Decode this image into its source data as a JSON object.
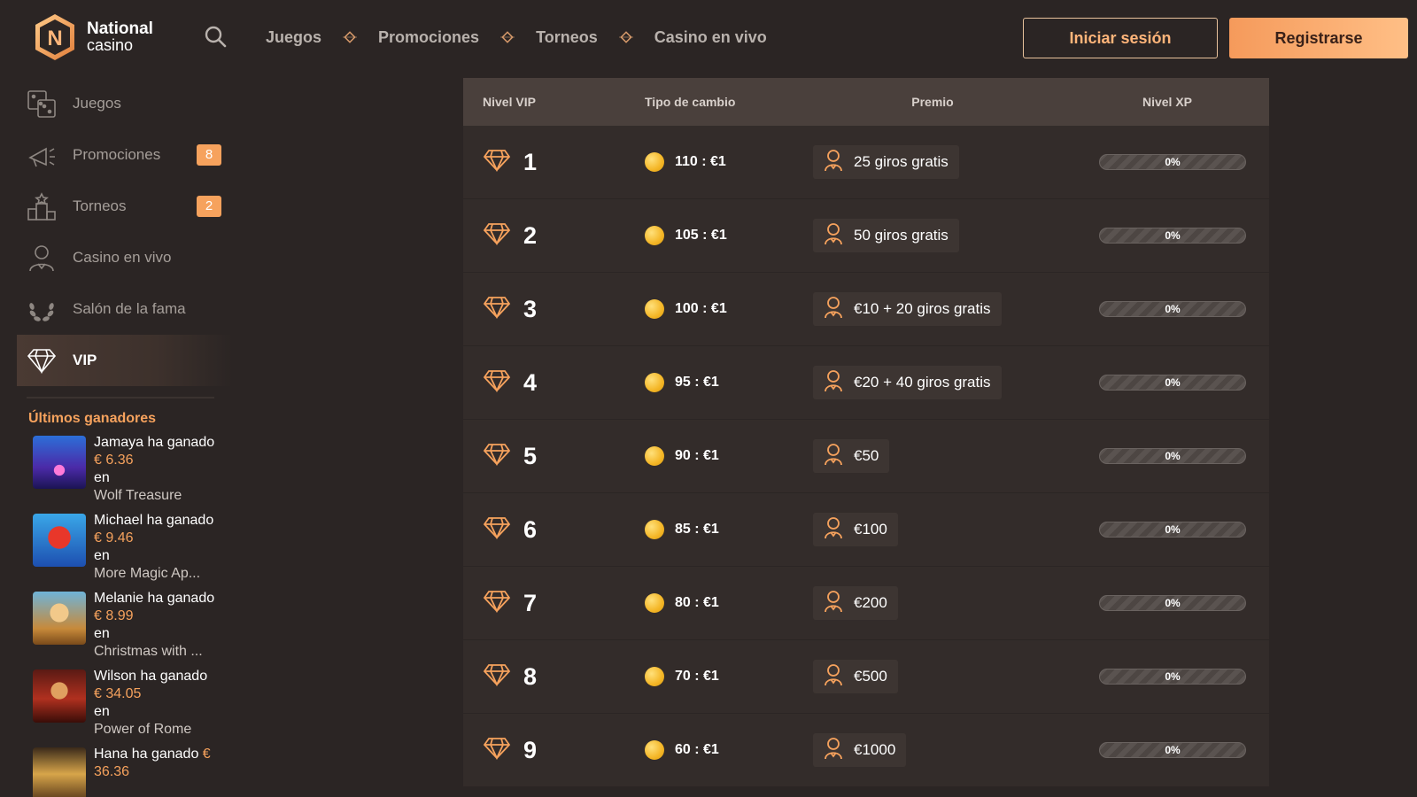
{
  "brand": {
    "line1": "National",
    "line2": "casino",
    "mark": "N"
  },
  "topnav": [
    "Juegos",
    "Promociones",
    "Torneos",
    "Casino en vivo"
  ],
  "auth": {
    "login": "Iniciar sesión",
    "register": "Registrarse"
  },
  "sidebar": {
    "items": [
      {
        "label": "Juegos",
        "icon": "games-icon",
        "badge": ""
      },
      {
        "label": "Promociones",
        "icon": "megaphone-icon",
        "badge": "8"
      },
      {
        "label": "Torneos",
        "icon": "podium-icon",
        "badge": "2"
      },
      {
        "label": "Casino en vivo",
        "icon": "dealer-icon",
        "badge": ""
      },
      {
        "label": "Salón de la fama",
        "icon": "laurel-icon",
        "badge": ""
      },
      {
        "label": "VIP",
        "icon": "diamond-icon",
        "badge": "",
        "active": true
      }
    ]
  },
  "winners": {
    "title": "Últimos ganadores",
    "won_word": "ha ganado",
    "in_word": "en",
    "items": [
      {
        "name": "Jamaya",
        "amount": "€ 6.36",
        "game": "Wolf Treasure"
      },
      {
        "name": "Michael",
        "amount": "€ 9.46",
        "game": "More Magic Ap..."
      },
      {
        "name": "Melanie",
        "amount": "€ 8.99",
        "game": "Christmas with ..."
      },
      {
        "name": "Wilson",
        "amount": "€ 34.05",
        "game": "Power of Rome"
      },
      {
        "name": "Hana",
        "amount": "€ 36.36",
        "game": ""
      }
    ]
  },
  "vip_table": {
    "headers": {
      "level": "Nivel VIP",
      "rate": "Tipo de cambio",
      "prize": "Premio",
      "xp": "Nivel XP"
    },
    "rows": [
      {
        "level": "1",
        "rate": "110 : €1",
        "prize": "25 giros gratis",
        "xp": "0%",
        "xp_value": 0
      },
      {
        "level": "2",
        "rate": "105 : €1",
        "prize": "50 giros gratis",
        "xp": "0%",
        "xp_value": 0
      },
      {
        "level": "3",
        "rate": "100 : €1",
        "prize": "€10 + 20 giros gratis",
        "xp": "0%",
        "xp_value": 0
      },
      {
        "level": "4",
        "rate": "95 : €1",
        "prize": "€20 + 40 giros gratis",
        "xp": "0%",
        "xp_value": 0
      },
      {
        "level": "5",
        "rate": "90 : €1",
        "prize": "€50",
        "xp": "0%",
        "xp_value": 0
      },
      {
        "level": "6",
        "rate": "85 : €1",
        "prize": "€100",
        "xp": "0%",
        "xp_value": 0
      },
      {
        "level": "7",
        "rate": "80 : €1",
        "prize": "€200",
        "xp": "0%",
        "xp_value": 0
      },
      {
        "level": "8",
        "rate": "70 : €1",
        "prize": "€500",
        "xp": "0%",
        "xp_value": 0
      },
      {
        "level": "9",
        "rate": "60 : €1",
        "prize": "€1000",
        "xp": "0%",
        "xp_value": 0
      }
    ]
  },
  "colors": {
    "accent": "#f6a25d",
    "background": "#2b2524",
    "row": "#332c2a",
    "header_row": "#4a403c"
  }
}
